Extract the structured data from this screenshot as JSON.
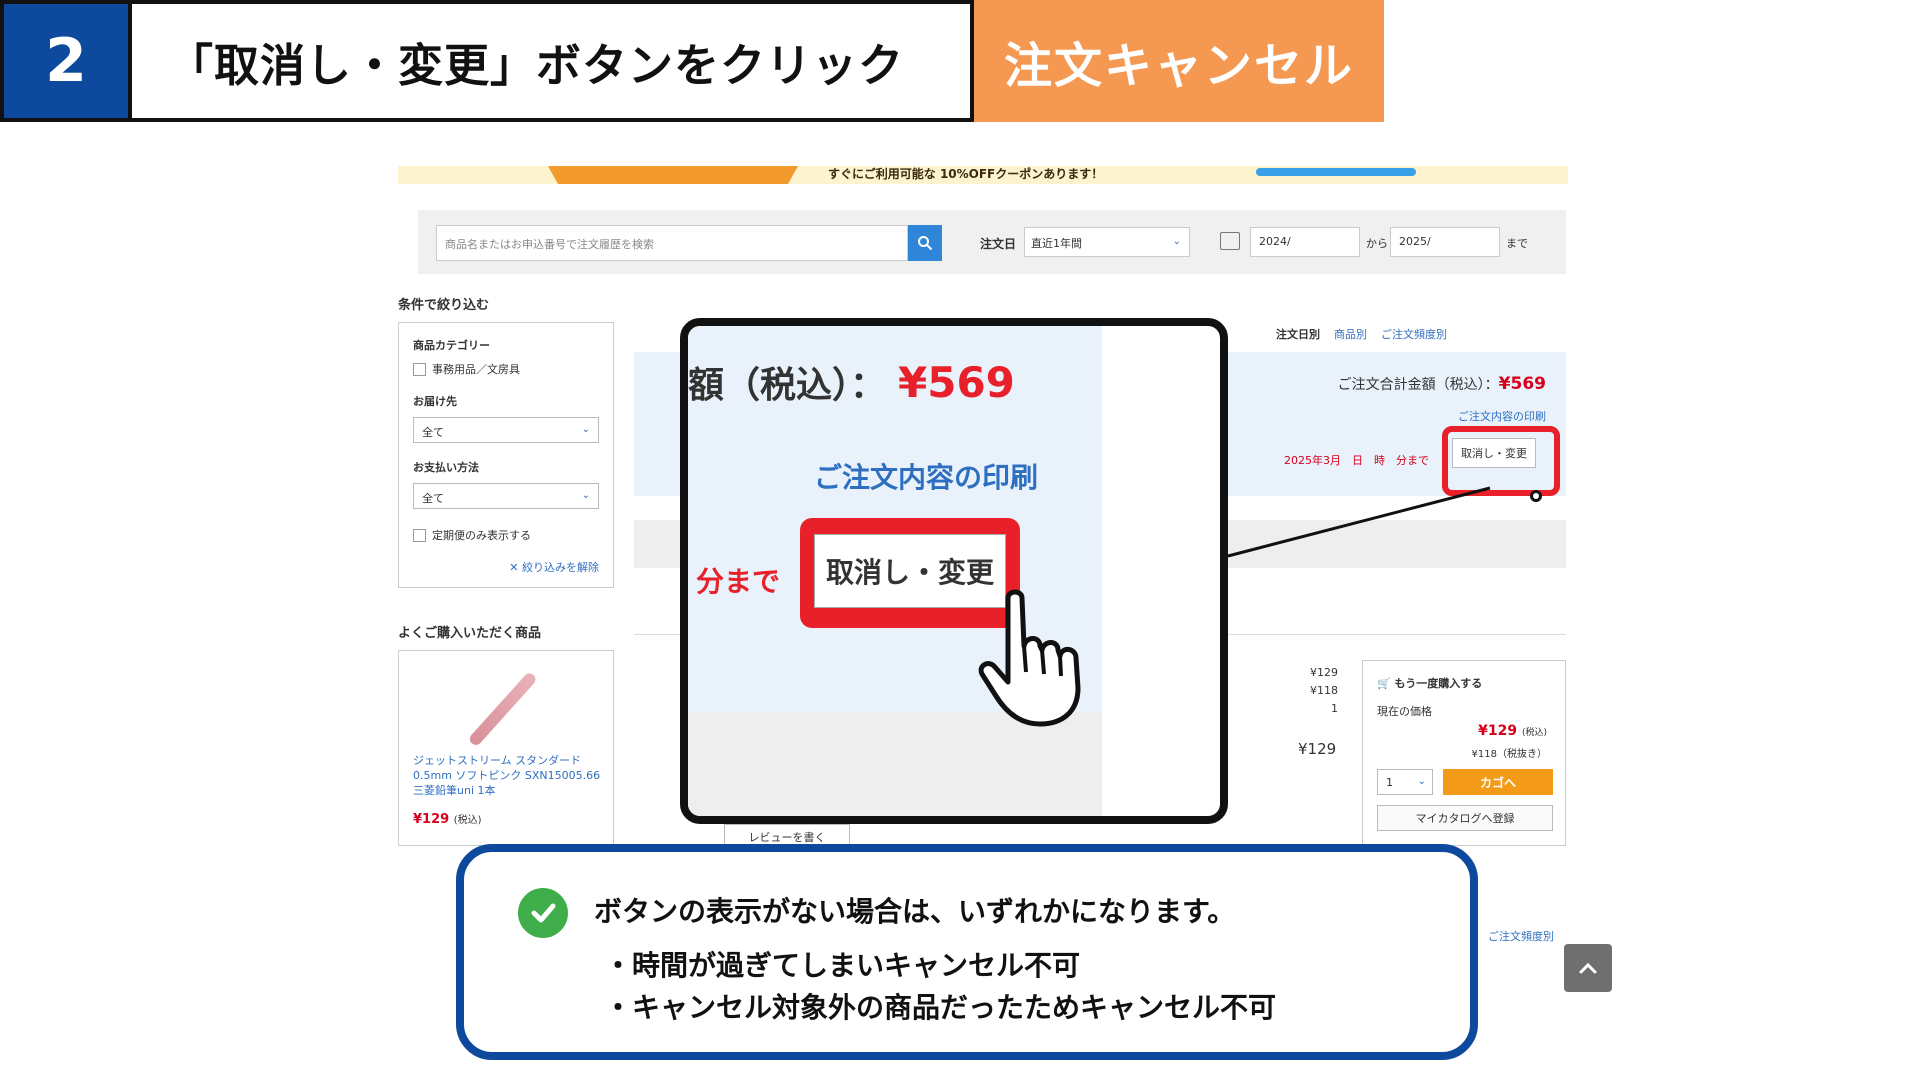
{
  "header": {
    "step_number": "2",
    "title": "「取消し・変更」ボタンをクリック",
    "tag": "注文キャンセル"
  },
  "screenshot": {
    "banner_text": "すぐにご利用可能な 10%OFFクーポンあります！",
    "search": {
      "placeholder": "商品名またはお申込番号で注文履歴を検索",
      "order_date_label": "注文日",
      "period": "直近1年間",
      "from_value": "2024/",
      "from_word": "から",
      "to_value": "2025/",
      "to_word": "まで"
    },
    "filters": {
      "title": "条件で絞り込む",
      "category_heading": "商品カテゴリー",
      "category_option": "事務用品／文房具",
      "delivery_heading": "お届け先",
      "delivery_value": "全て",
      "payment_heading": "お支払い方法",
      "payment_value": "全て",
      "regular_only": "定期便のみ表示する",
      "clear": "✕ 絞り込みを解除"
    },
    "frequent": {
      "title": "よくご購入いただく商品",
      "product_name": "ジェットストリーム スタンダード 0.5mm ソフトピンク SXN15005.66 三菱鉛筆uni 1本",
      "product_price": "¥129",
      "tax_note": "(税込)"
    },
    "view_toggles": {
      "by_date": "注文日別",
      "by_product": "商品別",
      "by_frequency": "ご注文頻度別"
    },
    "order": {
      "total_label": "ご注文合計金額（税込）：",
      "total_value": "¥569",
      "print_link": "ご注文内容の印刷",
      "deadline": "2025年3月　日　時　分まで",
      "cancel_button": "取消し・変更"
    },
    "item": {
      "price_incl": "¥129",
      "price_excl": "¥118",
      "qty": "1",
      "line_total": "¥129"
    },
    "reorder": {
      "title": "もう一度購入する",
      "price_label": "現在の価格",
      "price": "¥129",
      "price_tax": "(税込)",
      "price_ex": "¥118（税抜き）",
      "qty": "1",
      "cart_button": "カゴへ",
      "catalog_button": "マイカタログへ登録"
    },
    "review_button": "レビューを書く",
    "frequency_link": "ご注文頻度別"
  },
  "zoom": {
    "amount_label": "額（税込）：",
    "amount_value": "¥569",
    "print_link": "ご注文内容の印刷",
    "deadline_suffix": "分まで",
    "cancel_button": "取消し・変更"
  },
  "callout": {
    "main": "ボタンの表示がない場合は、いずれかになります。",
    "bullet_1": "・時間が過ぎてしまいキャンセル不可",
    "bullet_2": "・キャンセル対象外の商品だったためキャンセル不可"
  },
  "colors": {
    "navy": "#0d4a9e",
    "orange": "#f59852",
    "red": "#e8202a",
    "link_blue": "#2f6fc1",
    "check_green": "#3fae4a"
  }
}
